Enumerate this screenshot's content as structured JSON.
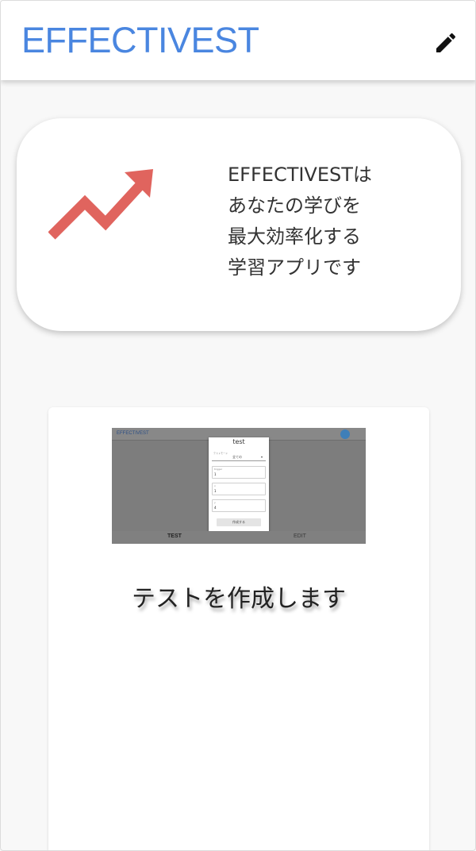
{
  "header": {
    "title": "EFFECTIVEST",
    "edit_icon": "pencil-icon"
  },
  "hero": {
    "icon": "trending-up-arrow-icon",
    "icon_color": "#e0645e",
    "lines": [
      "EFFECTIVESTは",
      "あなたの学びを",
      "最大効率化する",
      "学習アプリです"
    ]
  },
  "feature": {
    "caption": "テストを作成します",
    "preview": {
      "brand": "EFFECTIVEST",
      "dialog_title": "test",
      "select_label": "テストモード",
      "select_value": "全ての",
      "fields": [
        {
          "label": "trigger",
          "value": "1"
        },
        {
          "label": "x",
          "value": "1"
        },
        {
          "label": "y",
          "value": "4"
        }
      ],
      "submit_label": "作成する",
      "tabs": [
        "TEST",
        "EDIT"
      ]
    }
  },
  "colors": {
    "brand_blue": "#4a86e0",
    "background": "#f8f8f8",
    "card": "#ffffff"
  }
}
